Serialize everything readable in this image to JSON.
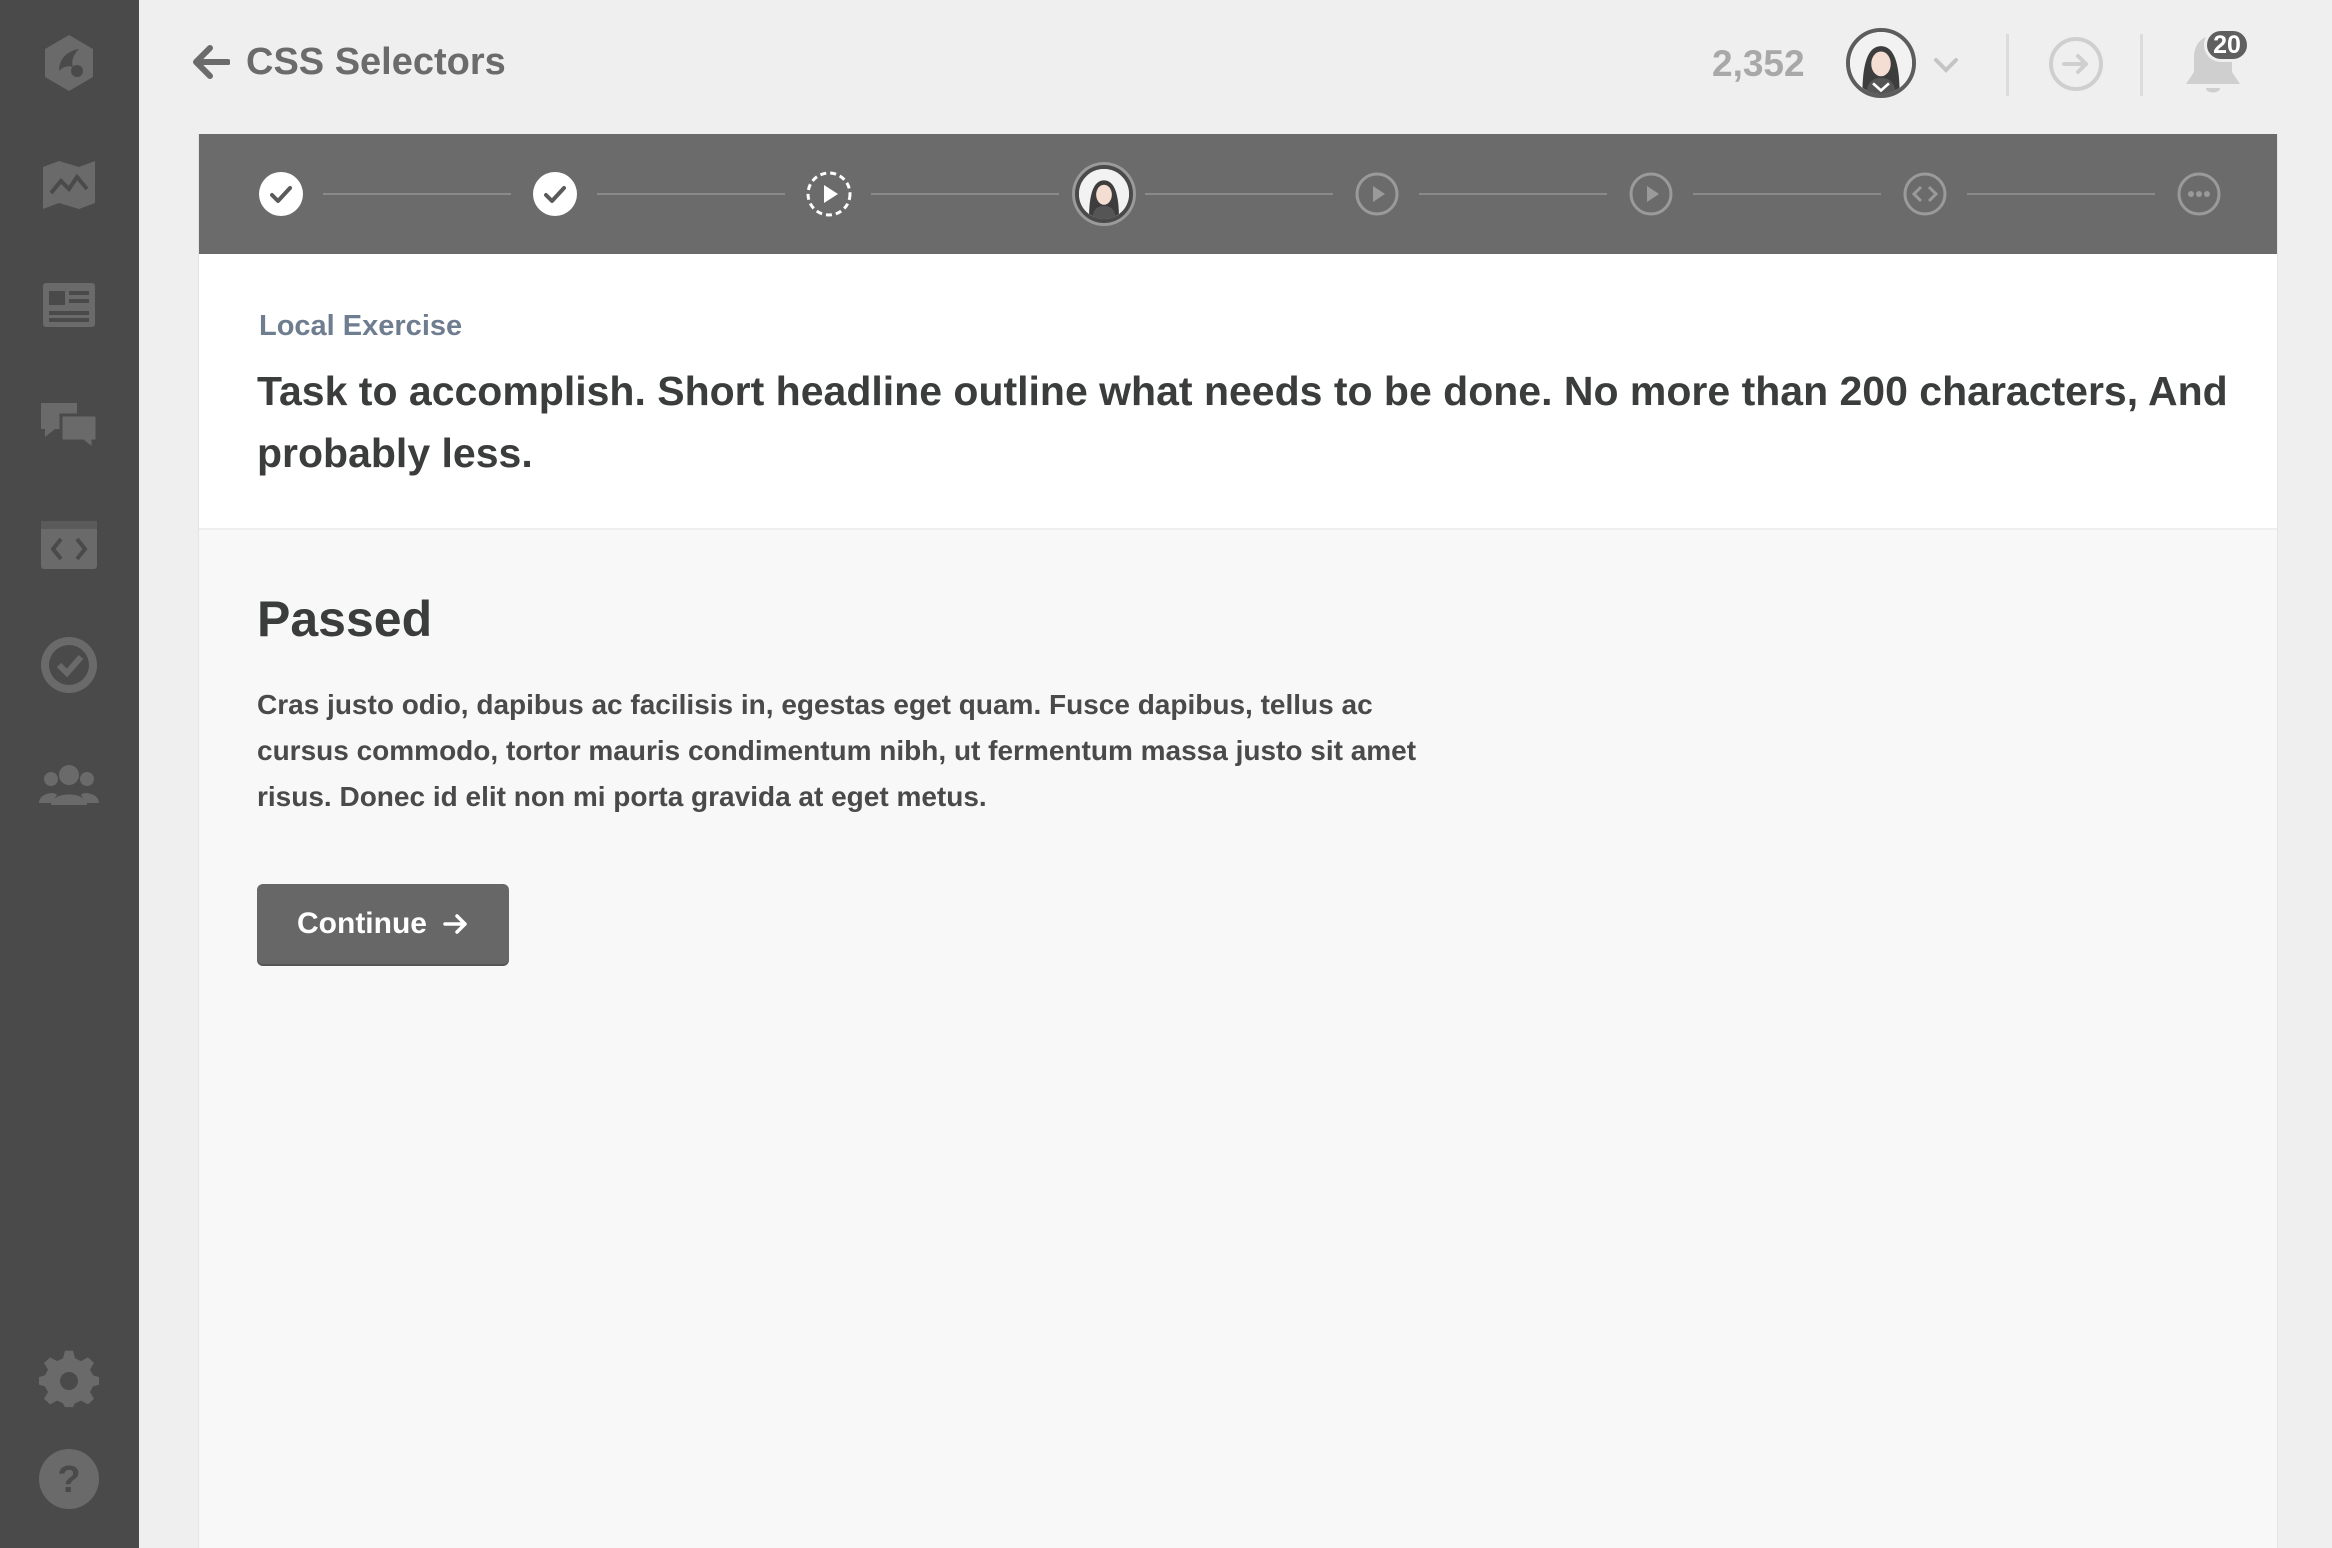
{
  "sidebar": {
    "items": [
      {
        "icon": "logo-icon"
      },
      {
        "icon": "map-icon"
      },
      {
        "icon": "library-icon"
      },
      {
        "icon": "community-icon"
      },
      {
        "icon": "workspace-icon"
      },
      {
        "icon": "quiz-check-icon"
      },
      {
        "icon": "team-icon"
      },
      {
        "icon": "settings-gear-icon"
      },
      {
        "icon": "help-icon"
      }
    ]
  },
  "header": {
    "back_icon": "arrow-left-icon",
    "title": "CSS Selectors",
    "points": "2,352",
    "notification_count": "20"
  },
  "steps": [
    {
      "state": "complete",
      "icon": "check-icon"
    },
    {
      "state": "complete",
      "icon": "check-icon"
    },
    {
      "state": "in-progress",
      "icon": "play-dashed-icon"
    },
    {
      "state": "current",
      "icon": "avatar"
    },
    {
      "state": "upcoming",
      "icon": "play-icon"
    },
    {
      "state": "upcoming",
      "icon": "play-icon"
    },
    {
      "state": "upcoming",
      "icon": "code-icon"
    },
    {
      "state": "upcoming",
      "icon": "more-icon"
    }
  ],
  "task": {
    "label": "Local Exercise",
    "headline": "Task to accomplish. Short headline outline what needs to be done. No more than 200 characters, And probably less."
  },
  "result": {
    "title": "Passed",
    "body": "Cras justo odio, dapibus ac facilisis in, egestas eget quam. Fusce dapibus, tellus ac cursus commodo, tortor mauris condimentum nibh, ut fermentum massa justo sit amet risus. Donec id elit non mi porta gravida at eget metus.",
    "continue_label": "Continue"
  },
  "colors": {
    "sidebar_bg": "#4a4a4a",
    "stepbar_bg": "#6b6b6b",
    "button_bg": "#676767",
    "label_color": "#6f7d90"
  }
}
